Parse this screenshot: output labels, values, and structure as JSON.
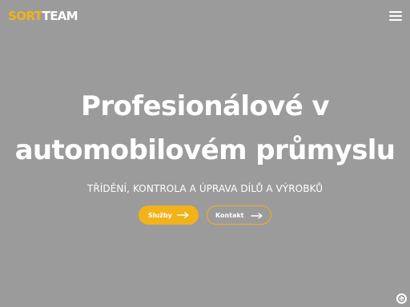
{
  "header": {
    "logo_part1": "SORT",
    "logo_part2": "TEAM",
    "menu_icon": "hamburger-icon"
  },
  "hero": {
    "title_line1": "Profesionálové v",
    "title_line2": "automobilovém průmyslu",
    "subtitle": "TŘÍDĚNÍ, KONTROLA A ÚPRAVA DÍLŮ A VÝROBKŮ"
  },
  "buttons": {
    "primary_label": "Služby",
    "secondary_label": "Kontakt",
    "arrow_icon": "arrow-right-icon"
  },
  "colors": {
    "accent": "#f2b21a",
    "background": "#9b9b9b",
    "text": "#ffffff"
  },
  "corner_icon": "cookie-settings-icon"
}
